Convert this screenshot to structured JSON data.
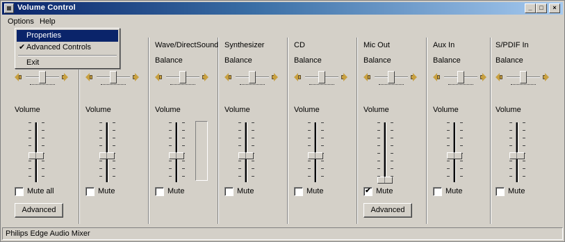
{
  "window": {
    "title": "Volume Control"
  },
  "caption_buttons": {
    "minimize": "_",
    "maximize": "□",
    "close": "×"
  },
  "menu": {
    "options": "Options",
    "help": "Help"
  },
  "dropdown": {
    "items": [
      {
        "label": "Properties",
        "checked": false,
        "highlighted": true
      },
      {
        "label": "Advanced Controls",
        "checked": true,
        "highlighted": false
      },
      {
        "label": "Exit",
        "checked": false,
        "highlighted": false
      }
    ],
    "check_glyph": "✔"
  },
  "columns": [
    {
      "title": "",
      "balance_label": "",
      "volume_label": "Volume",
      "mute_label": "Mute all",
      "muted": false,
      "advanced_label": "Advanced",
      "volume_level": 0.45
    },
    {
      "title": "",
      "balance_label": "",
      "volume_label": "Volume",
      "mute_label": "Mute",
      "muted": false,
      "advanced_label": "",
      "volume_level": 0.45
    },
    {
      "title": "Wave/DirectSound",
      "balance_label": "Balance",
      "volume_label": "Volume",
      "mute_label": "Mute",
      "muted": false,
      "advanced_label": "",
      "volume_level": 0.45
    },
    {
      "title": "Synthesizer",
      "balance_label": "Balance",
      "volume_label": "Volume",
      "mute_label": "Mute",
      "muted": false,
      "advanced_label": "",
      "volume_level": 0.45
    },
    {
      "title": "CD",
      "balance_label": "Balance",
      "volume_label": "Volume",
      "mute_label": "Mute",
      "muted": false,
      "advanced_label": "",
      "volume_level": 0.45
    },
    {
      "title": "Mic Out",
      "balance_label": "Balance",
      "volume_label": "Volume",
      "mute_label": "Mute",
      "muted": true,
      "advanced_label": "Advanced",
      "volume_level": 0.0
    },
    {
      "title": "Aux In",
      "balance_label": "Balance",
      "volume_label": "Volume",
      "mute_label": "Mute",
      "muted": false,
      "advanced_label": "",
      "volume_level": 0.45
    },
    {
      "title": "S/PDIF In",
      "balance_label": "Balance",
      "volume_label": "Volume",
      "mute_label": "Mute",
      "muted": false,
      "advanced_label": "",
      "volume_level": 0.45
    }
  ],
  "status": {
    "text": "Philips Edge Audio Mixer"
  },
  "colors": {
    "face": "#d4d0c8",
    "title_start": "#0a246a",
    "title_end": "#a6caf0",
    "highlight": "#0a246a",
    "speaker": "#c8a040"
  }
}
